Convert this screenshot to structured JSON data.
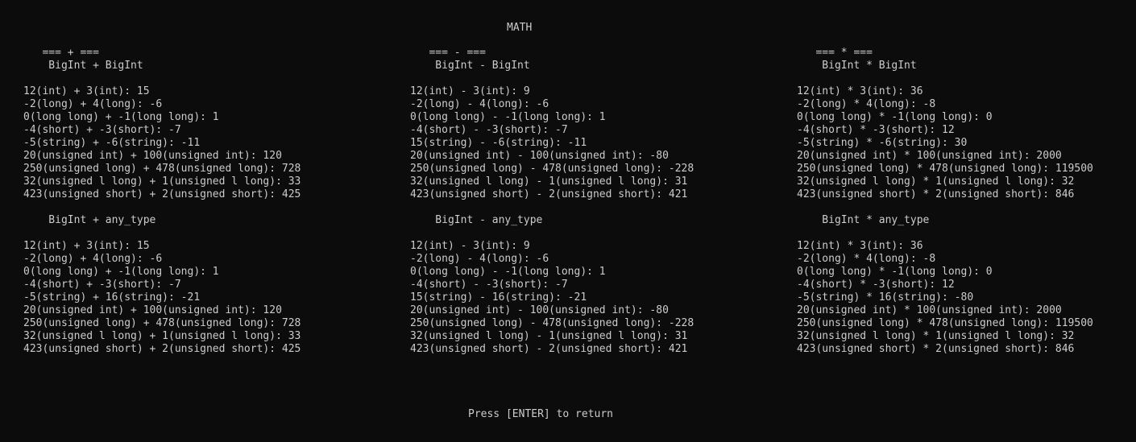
{
  "header": {
    "title": "MATH"
  },
  "columns": [
    {
      "op_header": "   === + ===",
      "section1_title": "    BigInt + BigInt",
      "section1_rows": [
        "12(int) + 3(int): 15",
        "-2(long) + 4(long): -6",
        "0(long long) + -1(long long): 1",
        "-4(short) + -3(short): -7",
        "-5(string) + -6(string): -11",
        "20(unsigned int) + 100(unsigned int): 120",
        "250(unsigned long) + 478(unsigned long): 728",
        "32(unsigned l long) + 1(unsigned l long): 33",
        "423(unsigned short) + 2(unsigned short): 425"
      ],
      "section2_title": "    BigInt + any_type",
      "section2_rows": [
        "12(int) + 3(int): 15",
        "-2(long) + 4(long): -6",
        "0(long long) + -1(long long): 1",
        "-4(short) + -3(short): -7",
        "-5(string) + 16(string): -21",
        "20(unsigned int) + 100(unsigned int): 120",
        "250(unsigned long) + 478(unsigned long): 728",
        "32(unsigned l long) + 1(unsigned l long): 33",
        "423(unsigned short) + 2(unsigned short): 425"
      ]
    },
    {
      "op_header": "   === - ===",
      "section1_title": "    BigInt - BigInt",
      "section1_rows": [
        "12(int) - 3(int): 9",
        "-2(long) - 4(long): -6",
        "0(long long) - -1(long long): 1",
        "-4(short) - -3(short): -7",
        "15(string) - -6(string): -11",
        "20(unsigned int) - 100(unsigned int): -80",
        "250(unsigned long) - 478(unsigned long): -228",
        "32(unsigned l long) - 1(unsigned l long): 31",
        "423(unsigned short) - 2(unsigned short): 421"
      ],
      "section2_title": "    BigInt - any_type",
      "section2_rows": [
        "12(int) - 3(int): 9",
        "-2(long) - 4(long): -6",
        "0(long long) - -1(long long): 1",
        "-4(short) - -3(short): -7",
        "15(string) - 16(string): -21",
        "20(unsigned int) - 100(unsigned int): -80",
        "250(unsigned long) - 478(unsigned long): -228",
        "32(unsigned l long) - 1(unsigned l long): 31",
        "423(unsigned short) - 2(unsigned short): 421"
      ]
    },
    {
      "op_header": "   === * ===",
      "section1_title": "    BigInt * BigInt",
      "section1_rows": [
        "12(int) * 3(int): 36",
        "-2(long) * 4(long): -8",
        "0(long long) * -1(long long): 0",
        "-4(short) * -3(short): 12",
        "-5(string) * -6(string): 30",
        "20(unsigned int) * 100(unsigned int): 2000",
        "250(unsigned long) * 478(unsigned long): 119500",
        "32(unsigned l long) * 1(unsigned l long): 32",
        "423(unsigned short) * 2(unsigned short): 846"
      ],
      "section2_title": "    BigInt * any_type",
      "section2_rows": [
        "12(int) * 3(int): 36",
        "-2(long) * 4(long): -8",
        "0(long long) * -1(long long): 0",
        "-4(short) * -3(short): 12",
        "-5(string) * 16(string): -80",
        "20(unsigned int) * 100(unsigned int): 2000",
        "250(unsigned long) * 478(unsigned long): 119500",
        "32(unsigned l long) * 1(unsigned l long): 32",
        "423(unsigned short) * 2(unsigned short): 846"
      ]
    }
  ],
  "footer": {
    "prompt": "Press [ENTER] to return"
  },
  "colors": {
    "background": "#0c0c0c",
    "text": "#cccccc"
  }
}
